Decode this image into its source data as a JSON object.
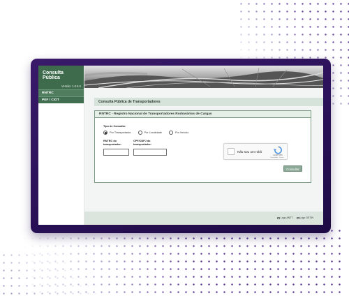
{
  "app": {
    "title": "Consulta Pública",
    "version": "Versão: 1.0.6.0"
  },
  "sidebar": {
    "items": [
      {
        "label": "RNTRC"
      },
      {
        "label": "PEF / CIOT"
      }
    ]
  },
  "main": {
    "page_title": "Consulta Pública de Transportadores",
    "panel_title": "RNTRC - Registro Nacional de Transportadores Rodoviários de Cargas",
    "query_type_label": "Tipo de Consulta:",
    "radios": [
      {
        "label": "Por Transportador",
        "checked": true
      },
      {
        "label": "Por Localidade",
        "checked": false
      },
      {
        "label": "Por Veículo",
        "checked": false
      }
    ],
    "rntrc_label": "RNTRC do transportador:",
    "cpf_label": "CPF/CNPJ do transportador:",
    "rntrc_value": "",
    "cpf_value": "",
    "captcha": {
      "label": "Não sou um robô",
      "brand": "reCAPTCHA",
      "links": "Privacidade - Termos"
    },
    "submit_label": "Consultar"
  },
  "footer": {
    "logo_antt": "Logo ANTT",
    "logo_getin": "Logo GETIN"
  },
  "colors": {
    "frame": "#2a1158",
    "brand_green": "#3d6b4c",
    "accent_green": "#8ca896",
    "dots": "#5b3b94"
  }
}
